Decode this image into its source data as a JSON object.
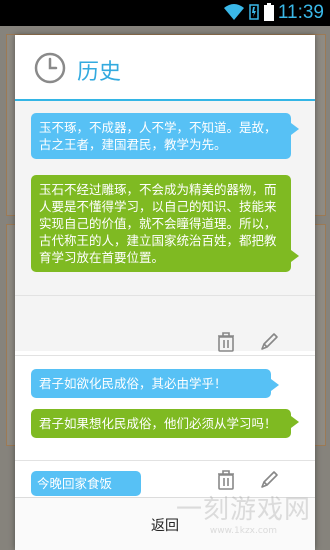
{
  "status_bar": {
    "time": "11:39"
  },
  "dialog": {
    "title": "历史",
    "entries": [
      {
        "question": "玉不琢，不成器，人不学，不知道。是故，古之王者，建国君民，教学为先。",
        "answer": "玉石不经过雕琢，不会成为精美的器物，而人要是不懂得学习，以自己的知识、技能来实现自己的价值，就不会瞳得道理。所以，古代称王的人，建立国家统治百姓，都把教育学习放在首要位置。"
      },
      {
        "question": "君子如欲化民成俗，其必由学乎！",
        "answer": "君子如果想化民成俗，他们必须从学习吗！"
      },
      {
        "question": "今晚回家食饭"
      }
    ],
    "return_label": "返回"
  },
  "watermark": {
    "text": "一刻游戏网",
    "sub": "www.1kzx.com"
  },
  "colors": {
    "accent": "#33b5e5",
    "question_bubble": "#57c1f5",
    "answer_bubble": "#7fba22"
  }
}
